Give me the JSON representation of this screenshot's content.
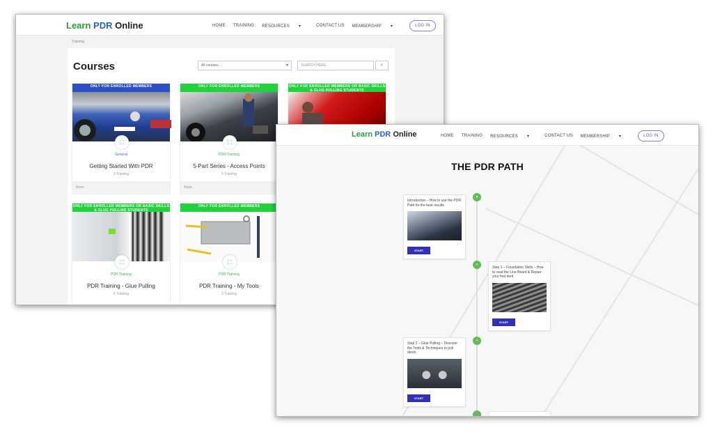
{
  "site": {
    "logo_learn": "Learn",
    "logo_pdr": "PDR",
    "logo_online": "Online"
  },
  "nav": {
    "home": "HOME",
    "training": "TRAINING",
    "resources": "RESOURCES",
    "contact": "CONTACT US",
    "membership": "MEMBERSHIP",
    "login": "LOG IN"
  },
  "courses_page": {
    "breadcrumb": "Training",
    "title": "Courses",
    "filter_value": "All courses...",
    "search_placeholder": "SEARCH HERE...",
    "cards": [
      {
        "band": "ONLY FOR ENROLLED MEMBERS",
        "band_color": "#2c4fc4",
        "category": "General",
        "title": "Getting Started With PDR",
        "count": "3 Training",
        "footer": "None"
      },
      {
        "band": "ONLY FOR ENROLLED MEMBERS",
        "band_color": "#22d23c",
        "category": "PDR Training",
        "title": "5-Part Series - Access Points",
        "count": "5 Training",
        "footer": "None"
      },
      {
        "band": "ONLY FOR ENROLLED MEMBERS OR BASIC SKILLS & GLUE PULLING STUDENTS",
        "band_color": "#22d23c"
      },
      {
        "band": "ONLY FOR ENROLLED MEMBERS OR BASIC SKILLS & GLUE PULLING STUDENTS",
        "band_color": "#22d23c",
        "category": "PDR Training",
        "title": "PDR Training - Glue Pulling",
        "count": "5 Training"
      },
      {
        "band": "ONLY FOR ENROLLED MEMBERS",
        "band_color": "#22d23c",
        "category": "PDR Training",
        "title": "PDR Training - My Tools",
        "count": "3 Training"
      }
    ]
  },
  "path_page": {
    "title": "THE PDR PATH",
    "steps": [
      {
        "text": "Introduction – How to use the PDR Path for the best results",
        "button": "START"
      },
      {
        "text": "Step 1 – Foundation Skills – How to read the Line Board & Repair your first dent",
        "button": "START"
      },
      {
        "text": "Step 2 – Glue Pulling – Discover the Tools & Techniques to pull dents",
        "button": "START"
      }
    ],
    "accent": "#5cbf4f"
  }
}
